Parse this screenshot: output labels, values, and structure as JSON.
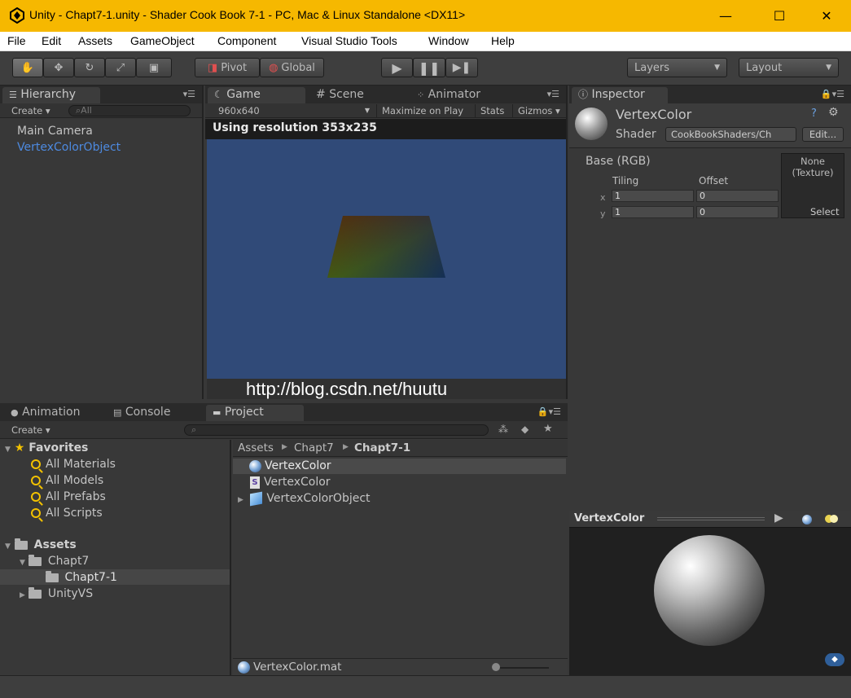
{
  "window": {
    "title": "Unity - Chapt7-1.unity - Shader Cook Book 7-1 - PC, Mac & Linux Standalone <DX11>",
    "minimize": "—",
    "maximize": "☐",
    "close": "✕"
  },
  "menu": [
    "File",
    "Edit",
    "Assets",
    "GameObject",
    "Component",
    "Visual Studio Tools",
    "Window",
    "Help"
  ],
  "toolbar": {
    "pivot": "Pivot",
    "global": "Global",
    "layers": "Layers",
    "layout": "Layout"
  },
  "hierarchy": {
    "tab": "Hierarchy",
    "create": "Create",
    "search_placeholder": "All",
    "items": [
      "Main Camera",
      "VertexColorObject"
    ]
  },
  "game": {
    "tabs": [
      "Game",
      "Scene",
      "Animator"
    ],
    "resolution_dropdown": "960x640",
    "maximize_on_play": "Maximize on Play",
    "stats": "Stats",
    "gizmos": "Gizmos",
    "resolution_banner": "Using resolution 353x235",
    "watermark": "http://blog.csdn.net/huutu"
  },
  "inspector": {
    "tab": "Inspector",
    "material_name": "VertexColor",
    "shader_label": "Shader",
    "shader_value": "CookBookShaders/Ch",
    "edit_button": "Edit...",
    "base_label": "Base (RGB)",
    "tiling_label": "Tiling",
    "offset_label": "Offset",
    "x_label": "x",
    "y_label": "y",
    "tiling_x": "1",
    "tiling_y": "1",
    "offset_x": "0",
    "offset_y": "0",
    "texture_none": "None",
    "texture_type": "(Texture)",
    "select_button": "Select",
    "preview_title": "VertexColor"
  },
  "bottom_tabs": [
    "Animation",
    "Console",
    "Project"
  ],
  "project": {
    "create": "Create",
    "favorites_label": "Favorites",
    "favorites": [
      "All Materials",
      "All Models",
      "All Prefabs",
      "All Scripts"
    ],
    "assets_label": "Assets",
    "folders": [
      "Chapt7",
      "Chapt7-1",
      "UnityVS"
    ],
    "breadcrumb": [
      "Assets",
      "Chapt7",
      "Chapt7-1"
    ],
    "files": [
      {
        "name": "VertexColor",
        "icon": "material-sphere-icon"
      },
      {
        "name": "VertexColor",
        "icon": "shader-script-icon"
      },
      {
        "name": "VertexColorObject",
        "icon": "prefab-icon"
      }
    ],
    "status_file": "VertexColor.mat"
  }
}
